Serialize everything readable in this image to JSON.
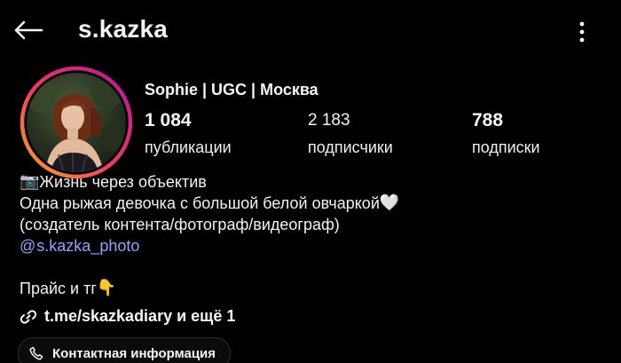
{
  "header": {
    "username": "s.kazka",
    "back_icon": "back-arrow-icon",
    "more_icon": "more-vertical-icon"
  },
  "profile": {
    "display_name": "Sophie | UGC | Москва",
    "avatar": "profile-photo",
    "story_ring_colors": [
      "#f58529",
      "#dd2a7b",
      "#8134af",
      "#515bd4"
    ]
  },
  "stats": {
    "posts": {
      "value": "1 084",
      "label": "публикации"
    },
    "followers": {
      "value": "2 183",
      "label": "подписчики"
    },
    "following": {
      "value": "788",
      "label": "подписки"
    }
  },
  "bio": {
    "line1_emoji": "📷",
    "line1": "Жизнь через объектив",
    "line2": "Одна рыжая девочка с большой белой овчаркой",
    "line2_emoji": "🤍",
    "line3": "(создатель контента/фотограф/видеограф)",
    "threads_glyph": "@",
    "threads_handle": "s.kazka_photo",
    "line5": "Прайс и тг",
    "line5_emoji": "👇"
  },
  "links": {
    "icon": "link-icon",
    "text": "t.me/skazkadiary и ещё 1"
  },
  "contact": {
    "icon": "phone-icon",
    "label": "Контактная информация"
  },
  "colors": {
    "background": "#000000",
    "text": "#f5f5f5",
    "link": "#8fa3ff"
  }
}
